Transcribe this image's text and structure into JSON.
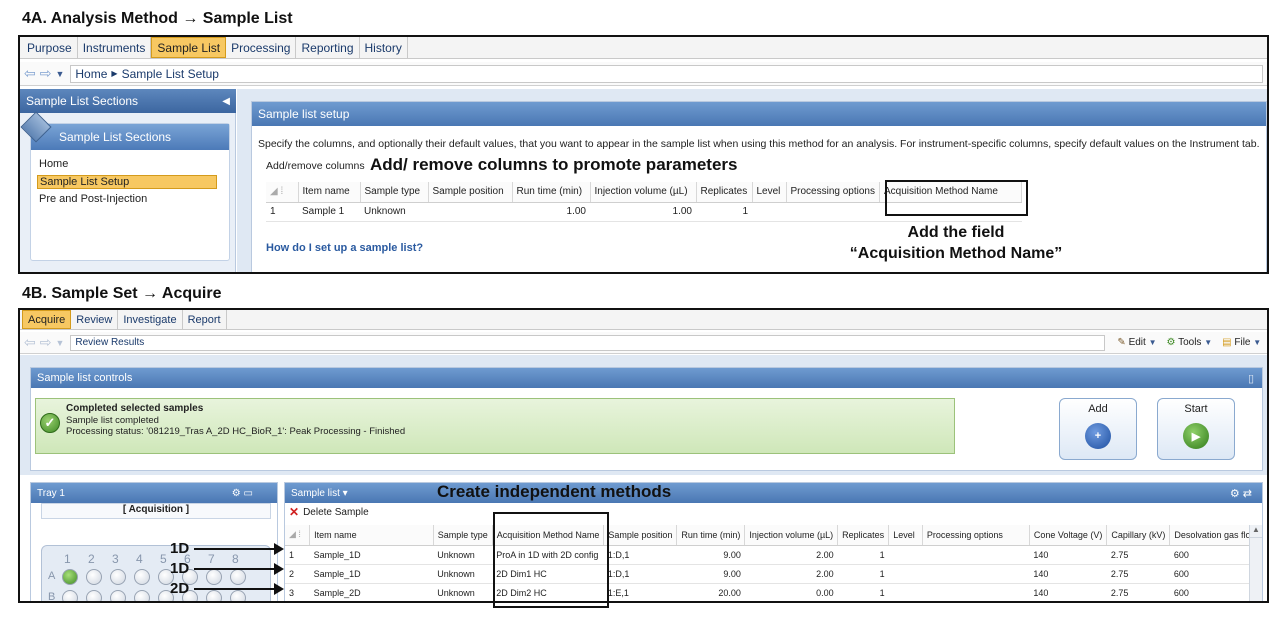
{
  "headings": {
    "a": "4A. Analysis Method → Sample List",
    "b": "4B. Sample Set → Acquire"
  },
  "top": {
    "tabs": [
      "Purpose",
      "Instruments",
      "Sample List",
      "Processing",
      "Reporting",
      "History"
    ],
    "breadcrumb": {
      "home": "Home",
      "current": "Sample List Setup"
    },
    "sidebar": {
      "title": "Sample List Sections",
      "panel_title": "Sample List Sections",
      "items": [
        "Home",
        "Sample List Setup",
        "Pre and Post-Injection"
      ]
    },
    "panel": {
      "title": "Sample list setup",
      "description": "Specify the columns, and optionally their default values, that you want to appear in the sample list when using this method for an analysis. For instrument-specific columns, specify default values on the Instrument tab.",
      "add_remove": "Add/remove columns",
      "help_link": "How do I set up a sample list?"
    },
    "table": {
      "headers": [
        "Item name",
        "Sample type",
        "Sample position",
        "Run time (min)",
        "Injection volume (µL)",
        "Replicates",
        "Level",
        "Processing options",
        "Acquisition Method Name"
      ],
      "rows": [
        {
          "num": "1",
          "cells": [
            "Sample 1",
            "Unknown",
            "",
            "1.00",
            "1.00",
            "1",
            "",
            "",
            ""
          ]
        }
      ]
    },
    "annotations": {
      "promote": "Add/ remove columns to promote parameters",
      "field_line1": "Add the field",
      "field_line2": "“Acquisition Method Name”"
    }
  },
  "bottom": {
    "tabs": [
      "Acquire",
      "Review",
      "Investigate",
      "Report"
    ],
    "breadcrumb": "Review Results",
    "toolbar": {
      "edit": "Edit",
      "tools": "Tools",
      "file": "File"
    },
    "controls": {
      "title": "Sample list controls",
      "status_title": "Completed selected samples",
      "status_line1": "Sample list completed",
      "status_line2": "Processing status: '081219_Tras A_2D HC_BioR_1': Peak Processing - Finished",
      "add": "Add",
      "start": "Start"
    },
    "tray": {
      "title": "Tray 1",
      "mode": "[ Acquisition ]",
      "columns": [
        "1",
        "2",
        "3",
        "4",
        "5",
        "6",
        "7",
        "8"
      ],
      "rows": [
        "A",
        "B"
      ]
    },
    "sample_list": {
      "title": "Sample list ▾",
      "delete": "Delete Sample",
      "headers": [
        "Item name",
        "Sample type",
        "Acquisition Method Name",
        "Sample position",
        "Run time (min)",
        "Injection volume (µL)",
        "Replicates",
        "Level",
        "Processing options",
        "Cone Voltage (V)",
        "Capillary (kV)",
        "Desolvation gas flow"
      ],
      "rows": [
        {
          "num": "1",
          "cells": [
            "Sample_1D",
            "Unknown",
            "ProA in 1D with 2D config",
            "1:D,1",
            "9.00",
            "2.00",
            "1",
            "",
            "",
            "140",
            "2.75",
            "600"
          ]
        },
        {
          "num": "2",
          "cells": [
            "Sample_1D",
            "Unknown",
            "2D Dim1 HC",
            "1:D,1",
            "9.00",
            "2.00",
            "1",
            "",
            "",
            "140",
            "2.75",
            "600"
          ]
        },
        {
          "num": "3",
          "cells": [
            "Sample_2D",
            "Unknown",
            "2D Dim2 HC",
            "1:E,1",
            "20.00",
            "0.00",
            "1",
            "",
            "",
            "140",
            "2.75",
            "600"
          ]
        }
      ]
    },
    "annotations": {
      "create": "Create independent methods",
      "labels": [
        "1D",
        "1D",
        "2D"
      ]
    }
  }
}
